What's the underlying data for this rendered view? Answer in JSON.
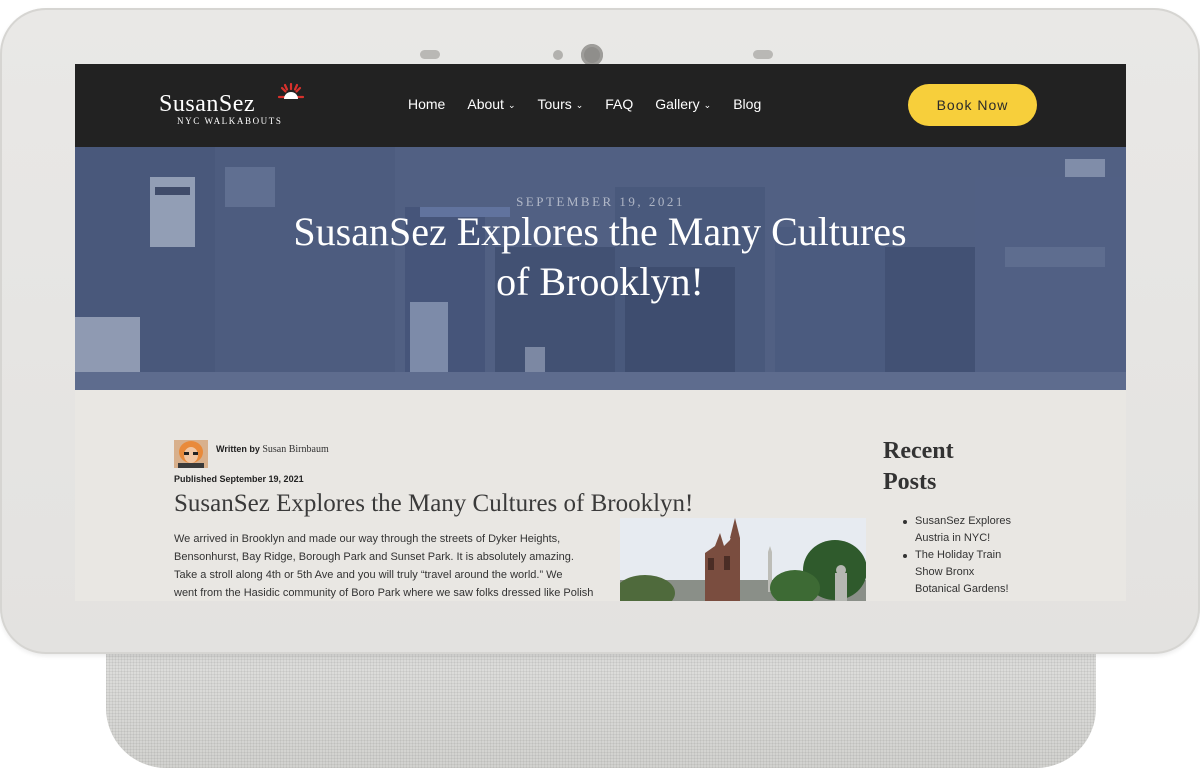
{
  "nav": {
    "logo_text": "SusanSez",
    "logo_subtitle": "NYC WALKABOUTS",
    "items": [
      {
        "label": "Home",
        "has_dropdown": false
      },
      {
        "label": "About",
        "has_dropdown": true
      },
      {
        "label": "Tours",
        "has_dropdown": true
      },
      {
        "label": "FAQ",
        "has_dropdown": false
      },
      {
        "label": "Gallery",
        "has_dropdown": true
      },
      {
        "label": "Blog",
        "has_dropdown": false
      }
    ],
    "dropdown_glyph": "⌄",
    "book_button": "Book Now"
  },
  "hero": {
    "date": "SEPTEMBER 19, 2021",
    "title_line1": "SusanSez Explores the Many Cultures",
    "title_line2": "of Brooklyn!"
  },
  "article": {
    "written_by_label": "Written by",
    "author": "Susan Birnbaum",
    "published_label": "Published",
    "published_date": "September 19, 2021",
    "title": "SusanSez Explores the Many Cultures of Brooklyn!",
    "body_lines": [
      "We arrived in Brooklyn and made our way through the streets of Dyker Heights,",
      "Bensonhurst, Bay Ridge, Borough Park and Sunset Park.  It is absolutely amazing.",
      "Take a stroll along 4th or 5th Ave and you will truly “travel around the world.” We",
      "went from the Hasidic community of Boro Park where we saw folks dressed like Polish"
    ]
  },
  "sidebar": {
    "title_line1": "Recent",
    "title_line2": "Posts",
    "posts": [
      {
        "line1": "SusanSez Explores",
        "line2": "Austria in NYC!"
      },
      {
        "line1": "The Holiday Train",
        "line2": "Show Bronx",
        "line3": "Botanical Gardens!"
      }
    ]
  },
  "colors": {
    "nav_bg": "#222222",
    "accent_button": "#f7cf3b",
    "page_bg": "#e9e7e3",
    "hero_tint": "#4f5d7c"
  }
}
